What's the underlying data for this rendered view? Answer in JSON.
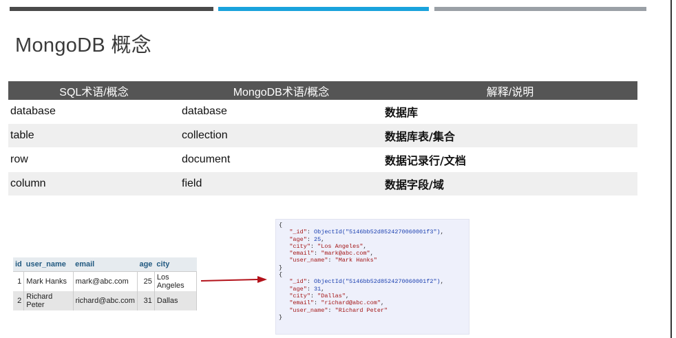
{
  "slide": {
    "title": "MongoDB 概念",
    "accent_colors": {
      "bar_dark": "#4a4a4a",
      "bar_blue": "#1aa3dc",
      "bar_gray": "#9aa0a6",
      "header_bg": "#555555"
    }
  },
  "concept_table": {
    "headers": [
      "SQL术语/概念",
      "MongoDB术语/概念",
      "解释/说明"
    ],
    "rows": [
      [
        "database",
        "database",
        "数据库"
      ],
      [
        "table",
        "collection",
        "数据库表/集合"
      ],
      [
        "row",
        "document",
        "数据记录行/文档"
      ],
      [
        "column",
        "field",
        "数据字段/域"
      ]
    ]
  },
  "sql_grid": {
    "headers": [
      "id",
      "user_name",
      "email",
      "age",
      "city"
    ],
    "rows": [
      [
        "1",
        "Mark Hanks",
        "mark@abc.com",
        "25",
        "Los Angeles"
      ],
      [
        "2",
        "Richard Peter",
        "richard@abc.com",
        "31",
        "Dallas"
      ]
    ]
  },
  "json_docs": [
    {
      "open": "{",
      "lines": [
        {
          "key": "\"_id\"",
          "sep": ": ",
          "value": "ObjectId(\"5146bb52d8524270060001f3\")",
          "tail": ","
        },
        {
          "key": "\"age\"",
          "sep": ": ",
          "value": "25",
          "tail": ","
        },
        {
          "key": "\"city\"",
          "sep": ": ",
          "value": "\"Los Angeles\"",
          "tail": ","
        },
        {
          "key": "\"email\"",
          "sep": ": ",
          "value": "\"mark@abc.com\"",
          "tail": ","
        },
        {
          "key": "\"user_name\"",
          "sep": ": ",
          "value": "\"Mark Hanks\"",
          "tail": ""
        }
      ],
      "close": "}"
    },
    {
      "open": "{",
      "lines": [
        {
          "key": "\"_id\"",
          "sep": ": ",
          "value": "ObjectId(\"5146bb52d8524270060001f2\")",
          "tail": ","
        },
        {
          "key": "\"age\"",
          "sep": ": ",
          "value": "31",
          "tail": ","
        },
        {
          "key": "\"city\"",
          "sep": ": ",
          "value": "\"Dallas\"",
          "tail": ","
        },
        {
          "key": "\"email\"",
          "sep": ": ",
          "value": "\"richard@abc.com\"",
          "tail": ","
        },
        {
          "key": "\"user_name\"",
          "sep": ": ",
          "value": "\"Richard Peter\"",
          "tail": ""
        }
      ],
      "close": "}"
    }
  ],
  "icons": {
    "arrow": "right-arrow-icon"
  }
}
